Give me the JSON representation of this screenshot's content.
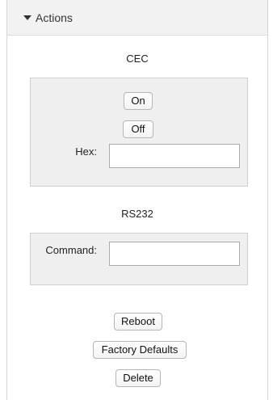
{
  "panel": {
    "title": "Actions",
    "toggle_icon": "caret-down-icon"
  },
  "cec": {
    "label": "CEC",
    "on_label": "On",
    "off_label": "Off",
    "hex_label": "Hex:",
    "hex_value": ""
  },
  "rs232": {
    "label": "RS232",
    "command_label": "Command:",
    "command_value": ""
  },
  "actions": {
    "reboot_label": "Reboot",
    "factory_defaults_label": "Factory Defaults",
    "delete_label": "Delete"
  }
}
